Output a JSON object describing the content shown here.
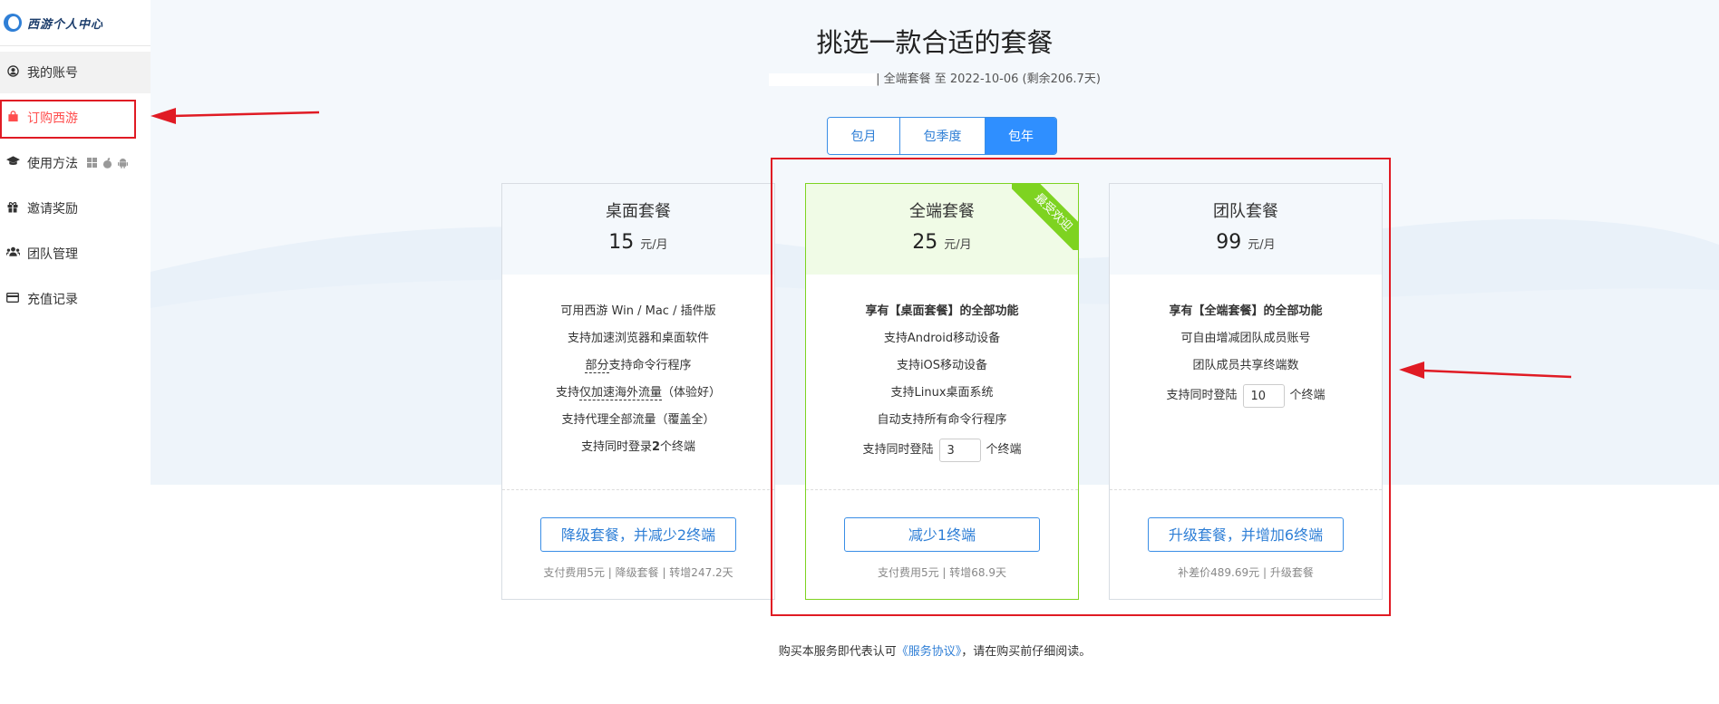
{
  "sidebar": {
    "logo_text": "西游个人中心",
    "items": [
      {
        "label": "我的账号",
        "icon": "user-circle-icon"
      },
      {
        "label": "订购西游",
        "icon": "shopping-bag-icon"
      },
      {
        "label": "使用方法",
        "icon": "graduation-cap-icon"
      },
      {
        "label": "邀请奖励",
        "icon": "gift-icon"
      },
      {
        "label": "团队管理",
        "icon": "users-icon"
      },
      {
        "label": "充值记录",
        "icon": "credit-card-icon"
      }
    ],
    "platform_icons": [
      "windows-icon",
      "apple-icon",
      "android-icon"
    ]
  },
  "header": {
    "title": "挑选一款合适的套餐",
    "subtitle": "| 全端套餐 至 2022-10-06 (剩余206.7天)"
  },
  "tabs": [
    {
      "label": "包月",
      "active": false
    },
    {
      "label": "包季度",
      "active": false
    },
    {
      "label": "包年",
      "active": true
    }
  ],
  "plans": [
    {
      "name": "桌面套餐",
      "price": "15",
      "unit": "元/月",
      "features": {
        "f1": "可用西游 Win / Mac / 插件版",
        "f2": "支持加速浏览器和桌面软件",
        "f3_pre": "部分",
        "f3_post": "支持命令行程序",
        "f4_pre": "支持",
        "f4_mid": "仅加速海外流量",
        "f4_post": "（体验好）",
        "f5": "支持代理全部流量（覆盖全）",
        "f6_pre": "支持同时登录",
        "f6_num": "2",
        "f6_post": "个终端"
      },
      "action": "降级套餐，并减少2终端",
      "note": "支付费用5元 | 降级套餐 | 转增247.2天"
    },
    {
      "name": "全端套餐",
      "price": "25",
      "unit": "元/月",
      "ribbon": "最受欢迎",
      "features": {
        "f1": "享有【桌面套餐】的全部功能",
        "f2": "支持Android移动设备",
        "f3": "支持iOS移动设备",
        "f4": "支持Linux桌面系统",
        "f5": "自动支持所有命令行程序",
        "f6_pre": "支持同时登陆",
        "f6_value": "3",
        "f6_post": "个终端"
      },
      "action": "减少1终端",
      "note": "支付费用5元 | 转增68.9天"
    },
    {
      "name": "团队套餐",
      "price": "99",
      "unit": "元/月",
      "features": {
        "f1": "享有【全端套餐】的全部功能",
        "f2": "可自由增减团队成员账号",
        "f3": "团队成员共享终端数",
        "f4_pre": "支持同时登陆",
        "f4_value": "10",
        "f4_post": "个终端"
      },
      "action": "升级套餐，并增加6终端",
      "note": "补差价489.69元 | 升级套餐"
    }
  ],
  "footer": {
    "pre": "购买本服务即代表认可",
    "link": "《服务协议》",
    "post": "，请在购买前仔细阅读。"
  },
  "colors": {
    "accent": "#2f8fff",
    "highlight_green": "#7ed321",
    "annotation_red": "#e01b24",
    "selected_nav": "#ff4d4d"
  }
}
